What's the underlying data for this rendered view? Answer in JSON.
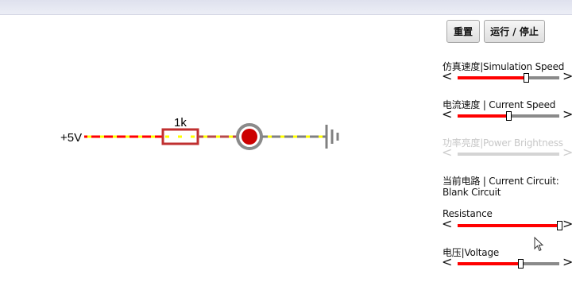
{
  "circuit": {
    "voltage_label": "+5V",
    "resistor_label": "1k"
  },
  "controls": {
    "reset_label": "重置",
    "run_stop_label": "运行 / 停止"
  },
  "panel": {
    "sim_speed": {
      "label": "仿真速度|Simulation Speed",
      "value": 0.67
    },
    "current_speed": {
      "label": "电流速度 | Current Speed",
      "value": 0.5
    },
    "power_brightness": {
      "label": "功率亮度|Power Brightness",
      "value": null,
      "enabled": false
    },
    "current_circuit_label": "当前电路 | Current Circuit:",
    "current_circuit_name": "Blank Circuit",
    "resistance": {
      "label": "Resistance",
      "value": 1.0
    },
    "voltage": {
      "label": "电压|Voltage",
      "value": 0.62
    },
    "arrow_left": "<",
    "arrow_right": ">"
  },
  "colors": {
    "wire_high": "#ff0000",
    "wire_low": "#808080",
    "current_dots": "#ffff00",
    "resistor": "#c03030",
    "led_fill": "#cc0000",
    "slider_fill": "#ff0000",
    "slider_track": "#8a8a8a"
  }
}
